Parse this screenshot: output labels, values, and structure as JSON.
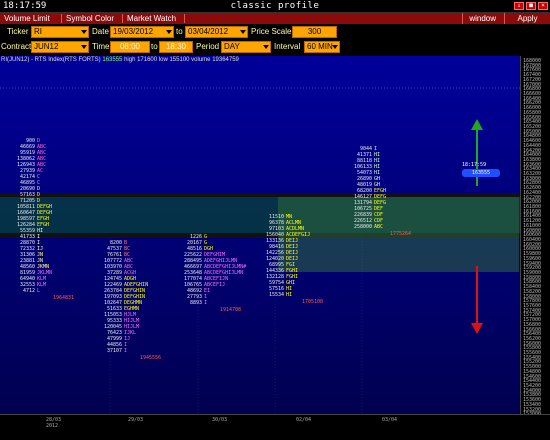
{
  "titlebar": {
    "clock": "18:17:59",
    "title": "classic profile",
    "buttons": [
      "↓",
      "■",
      "×"
    ]
  },
  "menu": {
    "items": [
      "Volume Limit",
      "Symbol Color",
      "Market Watch"
    ],
    "window": "window",
    "apply": "Apply"
  },
  "params": {
    "ticker_label": "Ticker",
    "ticker": "RI",
    "date_label": "Date",
    "date_from": "19/03/2012",
    "to_label": "to",
    "date_to": "03/04/2012",
    "price_scale_label": "Price Scale",
    "price_scale": "300",
    "contract_label": "Contract",
    "contract": "JUN12",
    "time_label": "Time",
    "time_from": "08:00",
    "time_to_label": "to",
    "time_to": "18:30",
    "period_label": "Period",
    "period": "DAY",
    "interval_label": "Interval",
    "interval": "60 MIN"
  },
  "chart_info": {
    "symbol": "RI(JUN12) - RTS Index(RTS FORTS)",
    "last": "163555",
    "high_label": "high",
    "high": "171600",
    "low_label": "low",
    "low": "155100",
    "volume_label": "volume",
    "volume": "19364759"
  },
  "price_marker": {
    "time": "18:17:59",
    "price": "163555"
  },
  "price_axis": [
    "168000",
    "167800",
    "167600",
    "167400",
    "167200",
    "167000",
    "166800",
    "166600",
    "166400",
    "166200",
    "166000",
    "165800",
    "165600",
    "165400",
    "165200",
    "165000",
    "164800",
    "164600",
    "164400",
    "164200",
    "164000",
    "163800",
    "163600",
    "163400",
    "163200",
    "163000",
    "162800",
    "162600",
    "162400",
    "162200",
    "162000",
    "161800",
    "161600",
    "161400",
    "161200",
    "161000",
    "160800",
    "160600",
    "160400",
    "160200",
    "160000",
    "159800",
    "159600",
    "159400",
    "159200",
    "159000",
    "158800",
    "158600",
    "158400",
    "158200",
    "158000",
    "157800",
    "157600",
    "157400",
    "157200",
    "157000",
    "156800",
    "156600",
    "156400",
    "156200",
    "156000",
    "155800",
    "155600",
    "155400",
    "155200",
    "155000",
    "154800",
    "154600",
    "154400",
    "154200",
    "154000",
    "153800",
    "153600",
    "153400",
    "153200",
    "153000"
  ],
  "time_axis": [
    {
      "label": "28/03",
      "sub": "2012"
    },
    {
      "label": "29/03",
      "sub": ""
    },
    {
      "label": "30/03",
      "sub": ""
    },
    {
      "label": "02/04",
      "sub": ""
    },
    {
      "label": "03/04",
      "sub": ""
    }
  ],
  "profiles": [
    {
      "rows": [
        {
          "v": "900",
          "l": "D",
          "c": "#ff7777"
        },
        {
          "v": "46669",
          "l": "ABC",
          "c": "#ff66cc"
        },
        {
          "v": "95919",
          "l": "ABC",
          "c": "#ff66cc"
        },
        {
          "v": "138062",
          "l": "ABC",
          "c": "#ff66cc"
        },
        {
          "v": "126943",
          "l": "ABC",
          "c": "#ff66cc"
        },
        {
          "v": "27939",
          "l": "AC",
          "c": "#ff66cc"
        },
        {
          "v": "42174",
          "l": "C",
          "c": "#cc99ff"
        },
        {
          "v": "46895",
          "l": "C",
          "c": "#cc99ff"
        },
        {
          "v": "20690",
          "l": "D",
          "c": "#ffff00"
        },
        {
          "v": "57163",
          "l": "D",
          "c": "#ffff00"
        },
        {
          "v": "71205",
          "l": "D",
          "c": "#ffff00"
        },
        {
          "v": "105811",
          "l": "DEFGH",
          "c": "#ffff00"
        },
        {
          "v": "160647",
          "l": "DEFGH",
          "c": "#ffff00"
        },
        {
          "v": "198597",
          "l": "EFGH",
          "c": "#ffff00"
        },
        {
          "v": "126284",
          "l": "EFGH",
          "c": "#ffff00"
        },
        {
          "v": "55359",
          "l": "HI",
          "c": "#ffff88"
        },
        {
          "v": "41733",
          "l": "I",
          "c": "#ffff88"
        },
        {
          "v": "28870",
          "l": "I",
          "c": "#ffff88"
        },
        {
          "v": "72332",
          "l": "IJ",
          "c": "#ffff88"
        },
        {
          "v": "31306",
          "l": "JN",
          "c": "#ffff88"
        },
        {
          "v": "23881",
          "l": "JN",
          "c": "#ffff88"
        },
        {
          "v": "48560",
          "l": "JKMN",
          "c": "#ffff88"
        },
        {
          "v": "81959",
          "l": "JKLMN",
          "c": "#ff66ff"
        },
        {
          "v": "64940",
          "l": "KLM",
          "c": "#ff66ff"
        },
        {
          "v": "32553",
          "l": "KLM",
          "c": "#ff66ff"
        },
        {
          "v": "4712",
          "l": "L",
          "c": "#ff66ff"
        }
      ],
      "total": "1964831"
    },
    {
      "rows": [
        {
          "v": "8200",
          "l": "B",
          "c": "#ff7777"
        },
        {
          "v": "47537",
          "l": "BC",
          "c": "#ff7777"
        },
        {
          "v": "76761",
          "l": "BC",
          "c": "#ff7777"
        },
        {
          "v": "107772",
          "l": "ABC",
          "c": "#ff66cc"
        },
        {
          "v": "103970",
          "l": "ABC",
          "c": "#ff66cc"
        },
        {
          "v": "37289",
          "l": "ACGH",
          "c": "#ff66cc"
        },
        {
          "v": "124745",
          "l": "ADGH",
          "c": "#ffff00"
        },
        {
          "v": "122469",
          "l": "ADEFGHIN",
          "c": "#ffff00"
        },
        {
          "v": "263784",
          "l": "DEFGHIN",
          "c": "#ffff00"
        },
        {
          "v": "197093",
          "l": "DEFGHIN",
          "c": "#ffff00"
        },
        {
          "v": "102647",
          "l": "DEGHMN",
          "c": "#ffff00"
        },
        {
          "v": "51633",
          "l": "EGHMN",
          "c": "#ffff00"
        },
        {
          "v": "115053",
          "l": "HJLM",
          "c": "#ff66ff"
        },
        {
          "v": "95333",
          "l": "HIJLM",
          "c": "#ff66ff"
        },
        {
          "v": "120045",
          "l": "HIJLM",
          "c": "#ff66ff"
        },
        {
          "v": "76423",
          "l": "IJKL",
          "c": "#ff66ff"
        },
        {
          "v": "47999",
          "l": "IJ",
          "c": "#ff66ff"
        },
        {
          "v": "44856",
          "l": "I",
          "c": "#ff66ff"
        },
        {
          "v": "37107",
          "l": "I",
          "c": "#ff66ff"
        }
      ],
      "total": "1945556"
    },
    {
      "rows": [
        {
          "v": "1226",
          "l": "G",
          "c": "#ffff00"
        },
        {
          "v": "20167",
          "l": "G",
          "c": "#ffff00"
        },
        {
          "v": "48516",
          "l": "DGH",
          "c": "#ffff00"
        },
        {
          "v": "225622",
          "l": "DEFGHIM",
          "c": "#ff66ff"
        },
        {
          "v": "288495",
          "l": "ADEFGHIJLMN",
          "c": "#ff66ff"
        },
        {
          "v": "466697",
          "l": "ABCDEFGHIJLMN#",
          "c": "#ff66ff"
        },
        {
          "v": "253648",
          "l": "ABCDEFGHIJLMN",
          "c": "#ff66ff"
        },
        {
          "v": "177074",
          "l": "ABCEFIJN",
          "c": "#ff66ff"
        },
        {
          "v": "106765",
          "l": "ABCEFIJ",
          "c": "#ff66ff"
        },
        {
          "v": "48692",
          "l": "EI",
          "c": "#ff66ff"
        },
        {
          "v": "27793",
          "l": "I",
          "c": "#ff66ff"
        },
        {
          "v": "8893",
          "l": "I",
          "c": "#ff66ff"
        }
      ],
      "total": "1914708"
    },
    {
      "rows": [
        {
          "v": "11510",
          "l": "MN",
          "c": "#ffff00"
        },
        {
          "v": "96378",
          "l": "ACLMN",
          "c": "#ffff00"
        },
        {
          "v": "97103",
          "l": "ACDLMN",
          "c": "#ffff00"
        },
        {
          "v": "156040",
          "l": "ACDEFGIJ",
          "c": "#ffff00"
        },
        {
          "v": "133136",
          "l": "DEIJ",
          "c": "#ffff00"
        },
        {
          "v": "98416",
          "l": "DEIJ",
          "c": "#ffff00"
        },
        {
          "v": "142256",
          "l": "DEIJ",
          "c": "#ffff00"
        },
        {
          "v": "124020",
          "l": "DEIJ",
          "c": "#ffff00"
        },
        {
          "v": "68995",
          "l": "FGI",
          "c": "#ffff00"
        },
        {
          "v": "144336",
          "l": "FGHI",
          "c": "#ffff00"
        },
        {
          "v": "132128",
          "l": "FGHI",
          "c": "#ffff00"
        },
        {
          "v": "59754",
          "l": "GHI",
          "c": "#ffff00"
        },
        {
          "v": "57516",
          "l": "HI",
          "c": "#ffff00"
        },
        {
          "v": "15534",
          "l": "HI",
          "c": "#ffff00"
        }
      ],
      "total": "1705108"
    },
    {
      "rows": [
        {
          "v": "9044",
          "l": "I",
          "c": "#ccffcc"
        },
        {
          "v": "41371",
          "l": "HI",
          "c": "#ccffcc"
        },
        {
          "v": "88118",
          "l": "HI",
          "c": "#ccffcc"
        },
        {
          "v": "106133",
          "l": "HI",
          "c": "#ccffcc"
        },
        {
          "v": "54073",
          "l": "HI",
          "c": "#ccffcc"
        },
        {
          "v": "26890",
          "l": "GH",
          "c": "#ccffcc"
        },
        {
          "v": "48019",
          "l": "GH",
          "c": "#ccffcc"
        },
        {
          "v": "68200",
          "l": "EFGH",
          "c": "#ffff00"
        },
        {
          "v": "146127",
          "l": "DEFG",
          "c": "#ffff00"
        },
        {
          "v": "131794",
          "l": "DEFG",
          "c": "#ffff00"
        },
        {
          "v": "106725",
          "l": "DEF",
          "c": "#ffff00"
        },
        {
          "v": "226839",
          "l": "CDF",
          "c": "#ffff00"
        },
        {
          "v": "226512",
          "l": "CDF",
          "c": "#ffff00"
        },
        {
          "v": "258000",
          "l": "ABC",
          "c": "#ffff00"
        }
      ],
      "total": "1775264"
    }
  ]
}
